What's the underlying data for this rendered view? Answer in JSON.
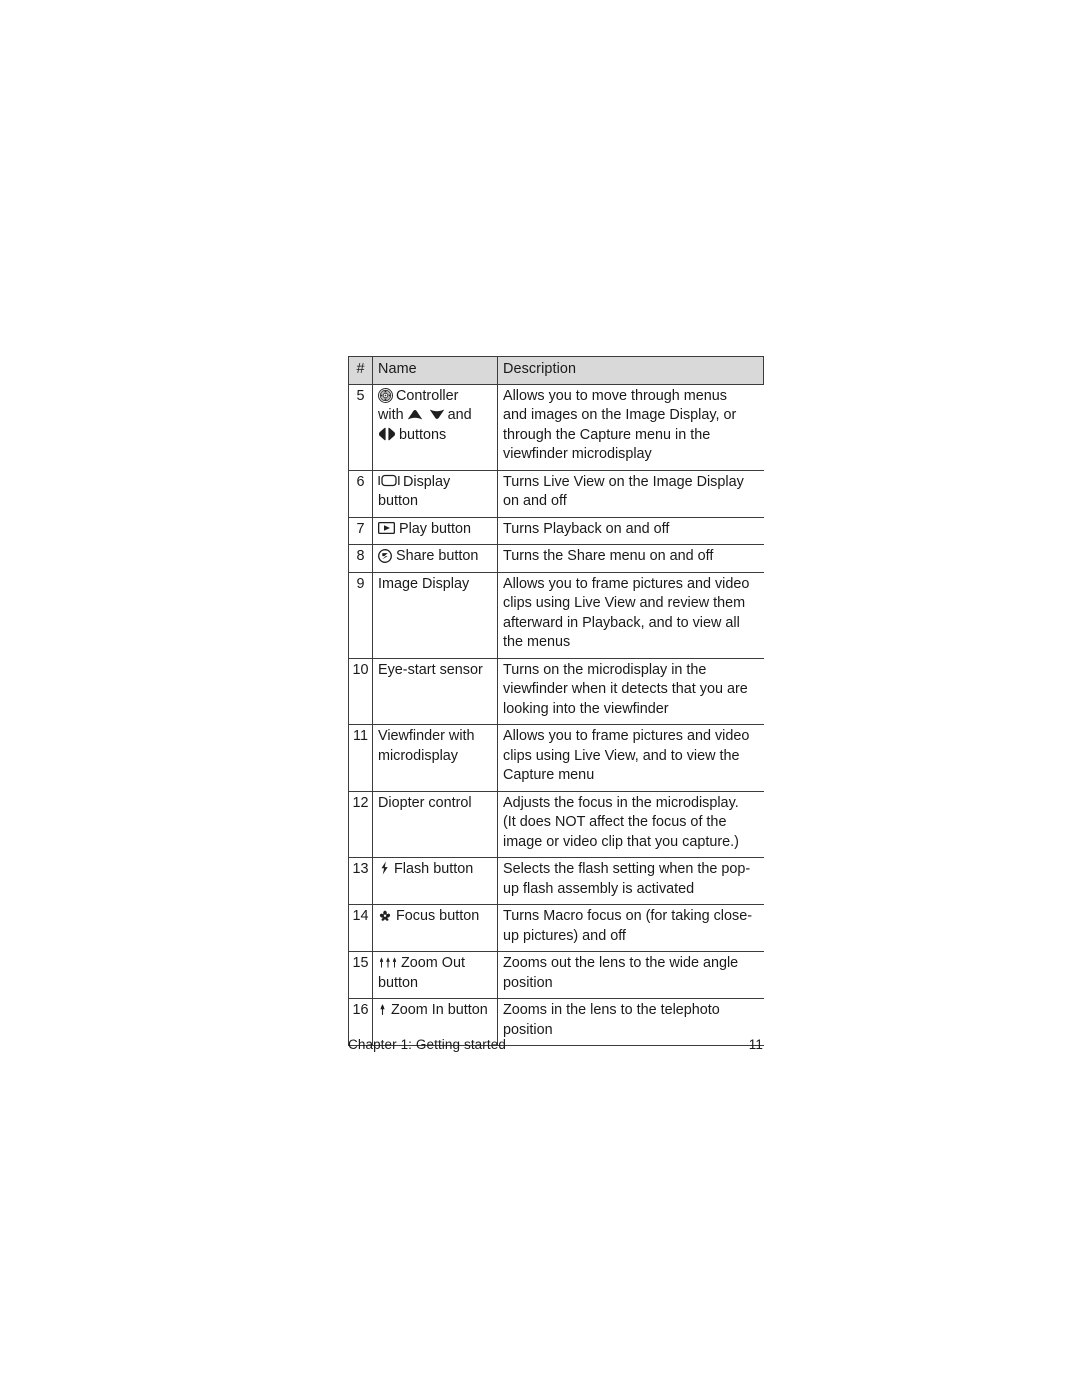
{
  "page": {
    "title": "Chapter 1: Getting started",
    "page_number": "11"
  },
  "table": {
    "headers": {
      "num": "#",
      "name": "Name",
      "description": "Description"
    },
    "rows": [
      {
        "num": "5",
        "name_lines": [
          "Controller",
          "with",
          "and",
          "buttons"
        ],
        "name_plain": "Controller with up down and left right buttons",
        "icons": [
          "controller-icon",
          "up-arrow-icon",
          "down-arrow-icon",
          "left-right-arrow-icon"
        ],
        "desc_lines": [
          "Allows you to move through menus",
          "and images on the Image Display, or",
          "through the Capture menu in the",
          "viewfinder microdisplay"
        ]
      },
      {
        "num": "6",
        "name_lines": [
          "Display",
          "button"
        ],
        "name_plain": "Display button",
        "icons": [
          "display-icon"
        ],
        "desc_lines": [
          "Turns Live View on the Image Display",
          "on and off"
        ]
      },
      {
        "num": "7",
        "name_lines": [
          "Play button"
        ],
        "name_plain": "Play button",
        "icons": [
          "play-icon"
        ],
        "desc_lines": [
          "Turns Playback on and off"
        ]
      },
      {
        "num": "8",
        "name_lines": [
          "Share button"
        ],
        "name_plain": "Share button",
        "icons": [
          "share-icon"
        ],
        "desc_lines": [
          "Turns the Share menu on and off"
        ]
      },
      {
        "num": "9",
        "name_lines": [
          "Image Display"
        ],
        "name_plain": "Image Display",
        "icons": [],
        "desc_lines": [
          "Allows you to frame pictures and video",
          "clips using Live View and review them",
          "afterward in Playback, and to view all",
          "the menus"
        ]
      },
      {
        "num": "10",
        "name_lines": [
          "Eye-start sensor"
        ],
        "name_plain": "Eye-start sensor",
        "icons": [],
        "desc_lines": [
          "Turns on the microdisplay in the",
          "viewfinder when it detects that you are",
          "looking into the viewfinder"
        ]
      },
      {
        "num": "11",
        "name_lines": [
          "Viewfinder with",
          "microdisplay"
        ],
        "name_plain": "Viewfinder with microdisplay",
        "icons": [],
        "desc_lines": [
          "Allows you to frame pictures and video",
          "clips using Live View, and to view the",
          "Capture menu"
        ]
      },
      {
        "num": "12",
        "name_lines": [
          "Diopter control"
        ],
        "name_plain": "Diopter control",
        "icons": [],
        "desc_lines": [
          "Adjusts the focus in the microdisplay.",
          "(It does NOT affect the focus of the",
          "image or video clip that you capture.)"
        ]
      },
      {
        "num": "13",
        "name_lines": [
          "Flash button"
        ],
        "name_plain": "Flash button",
        "icons": [
          "flash-icon"
        ],
        "desc_lines": [
          "Selects the flash setting when the pop-",
          "up flash assembly is activated"
        ]
      },
      {
        "num": "14",
        "name_lines": [
          "Focus button"
        ],
        "name_plain": "Focus button",
        "icons": [
          "macro-focus-icon"
        ],
        "desc_lines": [
          "Turns Macro focus on (for taking close-",
          "up pictures) and off"
        ]
      },
      {
        "num": "15",
        "name_lines": [
          "Zoom Out",
          "button"
        ],
        "name_plain": "Zoom Out button",
        "icons": [
          "zoom-out-icon"
        ],
        "desc_lines": [
          "Zooms out the lens to the wide angle",
          "position"
        ]
      },
      {
        "num": "16",
        "name_lines": [
          "Zoom In button"
        ],
        "name_plain": "Zoom In button",
        "icons": [
          "zoom-in-icon"
        ],
        "desc_lines": [
          "Zooms in the lens to the telephoto",
          "position"
        ]
      }
    ]
  },
  "colors": {
    "header_fill": "#d9d9d9",
    "rule": "#3c3c3c",
    "text": "#1a1a1a",
    "page_background": "#ffffff"
  }
}
